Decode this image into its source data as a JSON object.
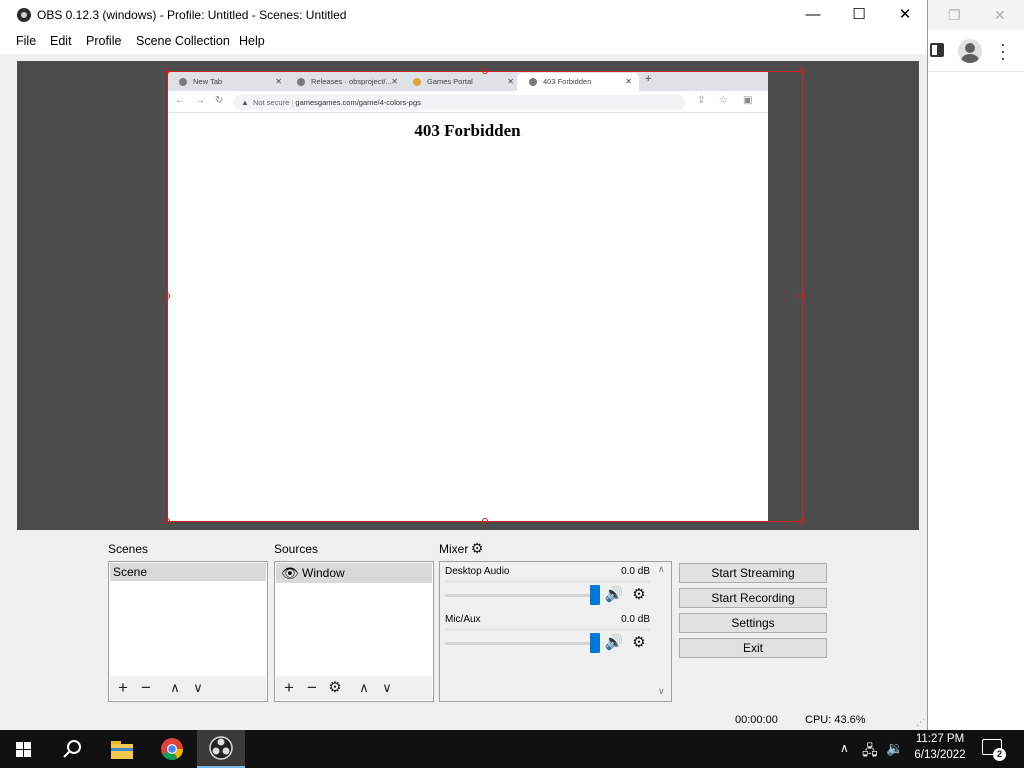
{
  "obs": {
    "title": "OBS 0.12.3 (windows) - Profile: Untitled - Scenes: Untitled",
    "window_controls": {
      "minimize": "—",
      "maximize": "☐",
      "close": "✕"
    },
    "menu": [
      "File",
      "Edit",
      "Profile",
      "Scene Collection",
      "Help"
    ],
    "preview": {
      "tabs": [
        {
          "label": "New Tab",
          "active": false
        },
        {
          "label": "Releases · obsproject/...",
          "active": false
        },
        {
          "label": "Games Portal",
          "active": false
        },
        {
          "label": "403 Forbidden",
          "active": true
        }
      ],
      "tab_close": "✕",
      "new_tab": "+",
      "security_label": "Not secure",
      "url": "gamesgames.com/game/4-colors-pgs",
      "heading": "403 Forbidden"
    },
    "scenes": {
      "label": "Scenes",
      "items": [
        "Scene"
      ]
    },
    "sources": {
      "label": "Sources",
      "items": [
        "Window"
      ]
    },
    "mixer": {
      "label": "Mixer",
      "tracks": [
        {
          "name": "Desktop Audio",
          "db": "0.0 dB",
          "volume": 1.0
        },
        {
          "name": "Mic/Aux",
          "db": "0.0 dB",
          "volume": 1.0
        }
      ]
    },
    "controls": {
      "start_streaming": "Start Streaming",
      "start_recording": "Start Recording",
      "settings": "Settings",
      "exit": "Exit"
    },
    "status": {
      "time": "00:00:00",
      "cpu": "CPU: 43.6%"
    }
  },
  "taskbar": {
    "time": "11:27 PM",
    "date": "6/13/2022",
    "notifications": "2",
    "apps": [
      "windows-start",
      "search",
      "file-explorer",
      "chrome",
      "obs"
    ]
  },
  "colors": {
    "selection": "#c82020",
    "slider": "#0078d7",
    "preview_bg": "#4c4c4c",
    "taskbar_bg": "#101010"
  }
}
